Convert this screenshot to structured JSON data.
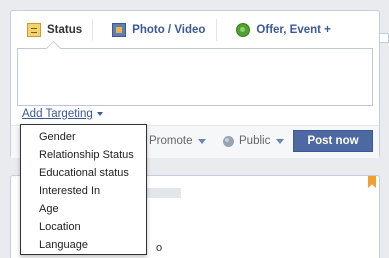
{
  "composer": {
    "tabs": [
      {
        "label": "Status",
        "icon": "status-icon"
      },
      {
        "label": "Photo / Video",
        "icon": "photo-video-icon"
      },
      {
        "label": "Offer, Event +",
        "icon": "offer-icon"
      }
    ],
    "status_input_value": "",
    "add_targeting_label": "Add Targeting",
    "promote_label": "Promote",
    "privacy_label": "Public",
    "post_button_label": "Post now"
  },
  "targeting_menu": {
    "items": [
      "Gender",
      "Relationship Status",
      "Educational status",
      "Interested In",
      "Age",
      "Location",
      "Language"
    ]
  },
  "feed": {
    "partial_text_1": "o",
    "partial_text_2": "",
    "bookmark_icon": "bookmark-icon"
  },
  "colors": {
    "brand": "#3b5998",
    "post_button": "#4e69a2",
    "background": "#e9ebee"
  }
}
